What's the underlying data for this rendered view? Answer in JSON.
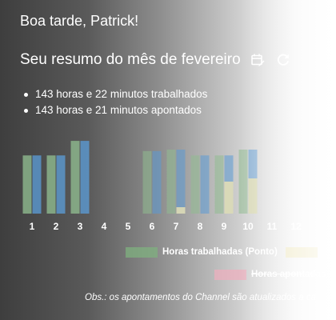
{
  "greeting": "Boa tarde, Patrick!",
  "summary": {
    "title": "Seu resumo do mês de fevereiro",
    "icons": {
      "calendar": "calendar-edit-icon",
      "refresh": "refresh-icon"
    },
    "items": [
      "143 horas e 22 minutos trabalhados",
      "143 horas e 21 minutos apontados"
    ]
  },
  "colors": {
    "worked": "#8fbc8f",
    "appointed_top": "#5b9bd5",
    "appointed_extra": "#ece3b3",
    "pending": "#f4b8c5"
  },
  "chart_data": {
    "type": "bar",
    "categories": [
      "1",
      "2",
      "3",
      "4",
      "5",
      "6",
      "7",
      "8",
      "9",
      "10",
      "11",
      "12"
    ],
    "series": [
      {
        "name": "Horas trabalhadas (Ponto)",
        "values": [
          8,
          8,
          10,
          0,
          0,
          8.6,
          8.8,
          8,
          8,
          8.8,
          0,
          0
        ]
      },
      {
        "name": "",
        "values": [
          8,
          8,
          10,
          0,
          0,
          8.6,
          8.8,
          8,
          8,
          8.8,
          0,
          0
        ]
      }
    ],
    "ylim": [
      0,
      11
    ],
    "legend": [
      "Horas trabalhadas (Ponto)",
      "",
      "Horas apontadas"
    ],
    "legend_placement": "bottom"
  },
  "footer": {
    "note": "Obs.: os apontamentos do Channel são atualizados a ca"
  }
}
